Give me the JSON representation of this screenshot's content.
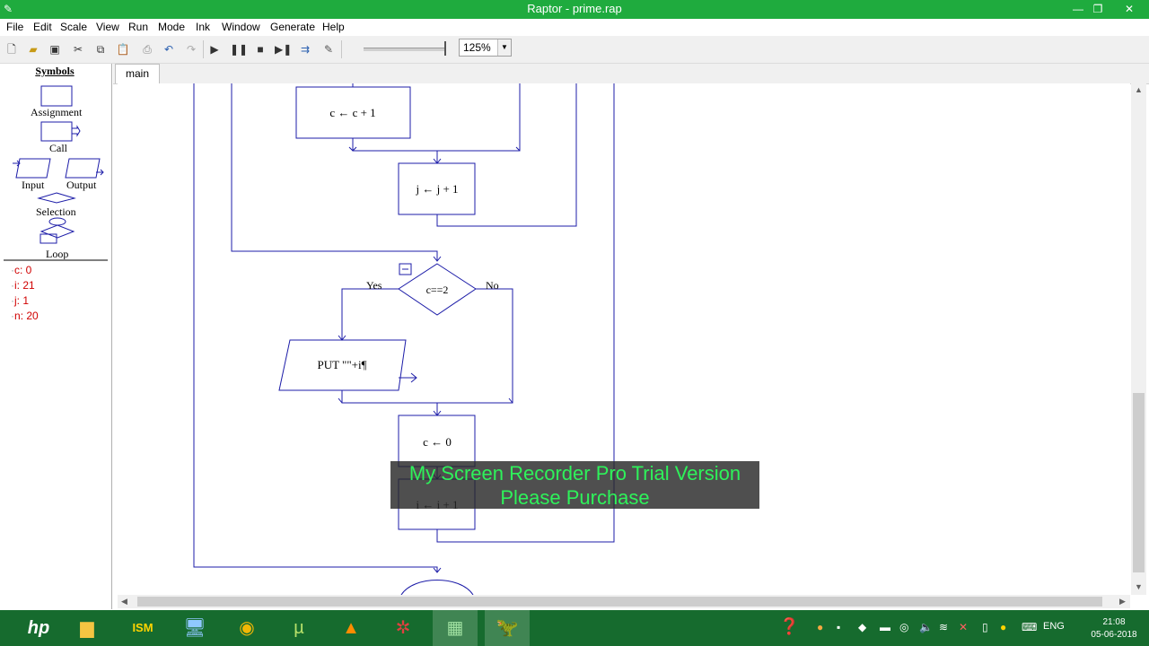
{
  "window": {
    "title": "Raptor - prime.rap",
    "minimize_glyph": "—",
    "restore_glyph": "❐",
    "close_glyph": "✕"
  },
  "menu": [
    "File",
    "Edit",
    "Scale",
    "View",
    "Run",
    "Mode",
    "Ink",
    "Window",
    "Generate",
    "Help"
  ],
  "toolbar": {
    "zoom": "125%",
    "buttons": [
      "new-icon",
      "open-icon",
      "save-icon",
      "cut-icon",
      "copy-icon",
      "paste-icon",
      "print-icon",
      "undo-icon",
      "redo-icon",
      "run-icon",
      "pause-icon",
      "stop-icon",
      "step-icon",
      "step-into-icon",
      "pen-icon"
    ]
  },
  "symbols": {
    "title": "Symbols",
    "assignment": "Assignment",
    "call": "Call",
    "input": "Input",
    "output": "Output",
    "selection": "Selection",
    "loop": "Loop"
  },
  "variables": [
    {
      "name": "c",
      "value": "0"
    },
    {
      "name": "i",
      "value": "21"
    },
    {
      "name": "j",
      "value": "1"
    },
    {
      "name": "n",
      "value": "20"
    }
  ],
  "tab": "main",
  "flowchart": {
    "assign_c_inc": "c ← c + 1",
    "assign_j_inc": "j ← j + 1",
    "decision": "c==2",
    "yes_label": "Yes",
    "no_label": "No",
    "output": "PUT \"\"+i¶",
    "assign_c_reset": "c ← 0",
    "assign_i_inc": "i ← i + 1"
  },
  "watermark": {
    "line1": "My Screen Recorder Pro Trial Version",
    "line2": "Please Purchase"
  },
  "taskbar": {
    "apps": [
      "hp-icon",
      "file-explorer-icon",
      "ism-icon",
      "computer-icon",
      "chrome-icon",
      "utorrent-icon",
      "vlc-icon",
      "network-icon",
      "task-manager-icon",
      "raptor-icon"
    ],
    "tray_lang": "ENG",
    "time": "21:08",
    "date": "05-06-2018"
  },
  "colors": {
    "titlebar": "#1fab3e",
    "taskbar": "#166b2e",
    "flow_line": "#1c1ca8",
    "variable_text": "#d00000",
    "watermark_text": "#2ef25a"
  }
}
